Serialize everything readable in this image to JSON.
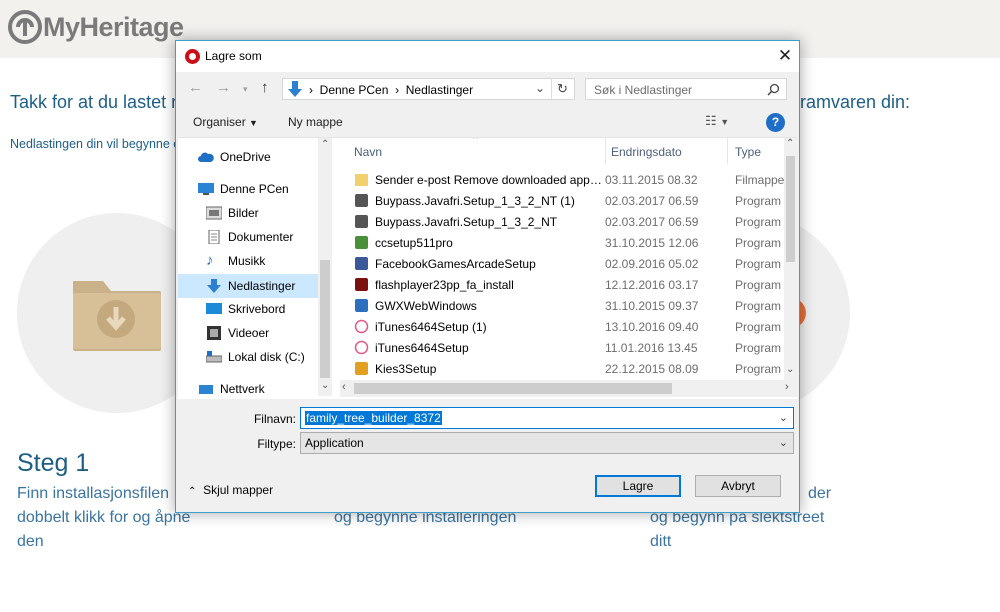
{
  "background": {
    "logo_text": "MyHeritage",
    "thanks_left": "Takk for at du lastet n",
    "thanks_right": "ramvaren din:",
    "download_note": "Nedlastingen din vil begynne c",
    "step1_title": "Steg 1",
    "step1_text": [
      "Finn installasjonsfilen",
      "dobbelt klikk for og åpne",
      "den"
    ],
    "step2_text": [
      "og begynne installeringen"
    ],
    "step3_text": [
      "der",
      "og begynn på slektstreet",
      "ditt"
    ]
  },
  "dialog": {
    "title": "Lagre som",
    "close_symbol": "✕",
    "address": {
      "crumbs": [
        "Denne PCen",
        "Nedlastinger"
      ],
      "separator": "›"
    },
    "search_placeholder": "Søk i Nedlastinger",
    "toolbar": {
      "organize": "Organiser",
      "new_folder": "Ny mappe",
      "help": "?"
    },
    "nav_items": [
      {
        "label": "OneDrive",
        "icon": "cloud-icon",
        "indent": 0
      },
      {
        "label": "Denne PCen",
        "icon": "computer-icon",
        "indent": 0
      },
      {
        "label": "Bilder",
        "icon": "pictures-icon",
        "indent": 1
      },
      {
        "label": "Dokumenter",
        "icon": "document-icon",
        "indent": 1
      },
      {
        "label": "Musikk",
        "icon": "music-icon",
        "indent": 1
      },
      {
        "label": "Nedlastinger",
        "icon": "download-icon",
        "indent": 1,
        "selected": true
      },
      {
        "label": "Skrivebord",
        "icon": "desktop-icon",
        "indent": 1
      },
      {
        "label": "Videoer",
        "icon": "video-icon",
        "indent": 1
      },
      {
        "label": "Lokal disk (C:)",
        "icon": "drive-icon",
        "indent": 1
      },
      {
        "label": "Nettverk",
        "icon": "network-icon",
        "indent": 0
      }
    ],
    "columns": {
      "name": "Navn",
      "date": "Endringsdato",
      "type": "Type"
    },
    "files": [
      {
        "name": "Sender e-post Remove downloaded apps...",
        "date": "03.11.2015 08.32",
        "type": "Filmappe",
        "icon": "folder-icon"
      },
      {
        "name": "Buypass.Javafri.Setup_1_3_2_NT (1)",
        "date": "02.03.2017 06.59",
        "type": "Program",
        "icon": "installer-icon"
      },
      {
        "name": "Buypass.Javafri.Setup_1_3_2_NT",
        "date": "02.03.2017 06.59",
        "type": "Program",
        "icon": "installer-icon"
      },
      {
        "name": "ccsetup511pro",
        "date": "31.10.2015 12.06",
        "type": "Program",
        "icon": "ccleaner-icon"
      },
      {
        "name": "FacebookGamesArcadeSetup",
        "date": "02.09.2016 05.02",
        "type": "Program",
        "icon": "facebook-games-icon"
      },
      {
        "name": "flashplayer23pp_fa_install",
        "date": "12.12.2016 03.17",
        "type": "Program",
        "icon": "flash-icon"
      },
      {
        "name": "GWXWebWindows",
        "date": "31.10.2015 09.37",
        "type": "Program",
        "icon": "window-app-icon"
      },
      {
        "name": "iTunes6464Setup (1)",
        "date": "13.10.2016 09.40",
        "type": "Program",
        "icon": "itunes-icon"
      },
      {
        "name": "iTunes6464Setup",
        "date": "11.01.2016 13.45",
        "type": "Program",
        "icon": "itunes-icon"
      },
      {
        "name": "Kies3Setup",
        "date": "22.12.2015 08.09",
        "type": "Program",
        "icon": "kies-icon"
      }
    ],
    "filename_label": "Filnavn:",
    "filename_value": "family_tree_builder_8372",
    "filetype_label": "Filtype:",
    "filetype_value": "Application",
    "hide_folders": "Skjul mapper",
    "save_button": "Lagre",
    "cancel_button": "Avbryt"
  },
  "colors": {
    "accent": "#0078d7",
    "page_text": "#1d5e86",
    "opera_red": "#cc0f16"
  }
}
